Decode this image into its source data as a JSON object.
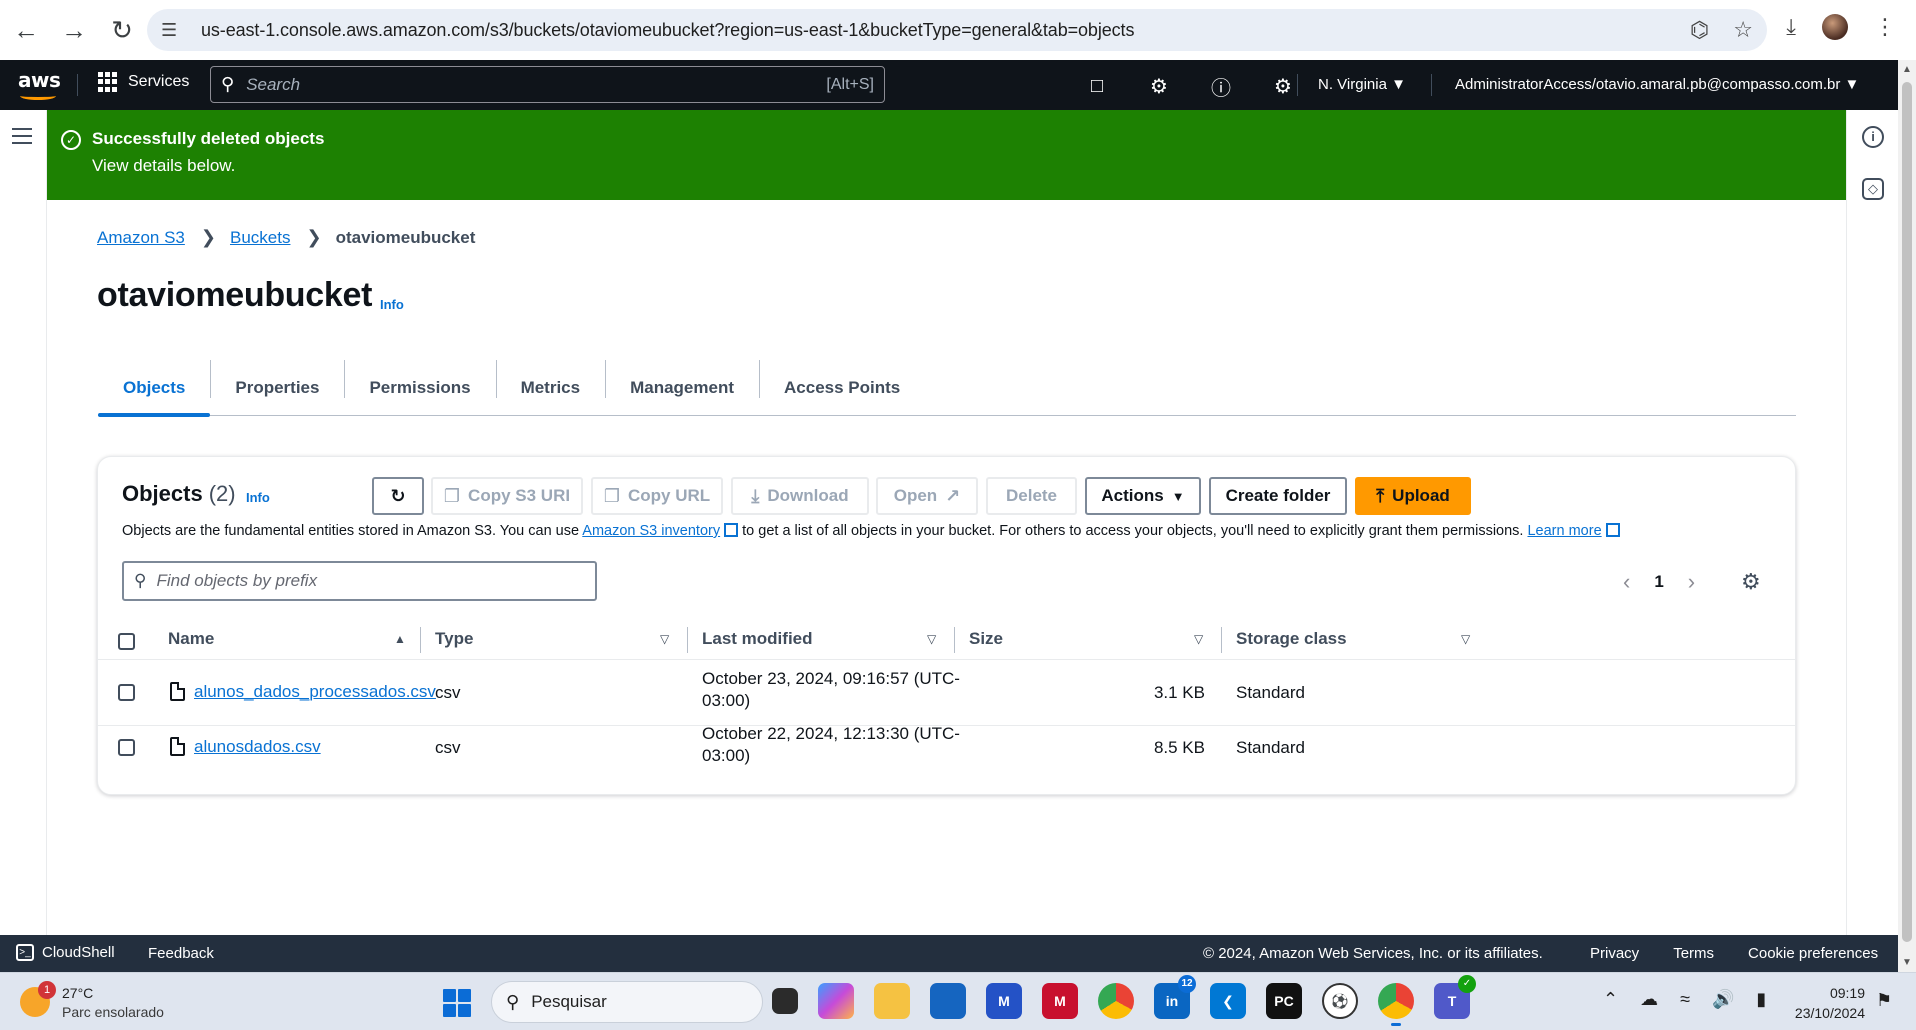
{
  "browser": {
    "url": "us-east-1.console.aws.amazon.com/s3/buckets/otaviomeubucket?region=us-east-1&bucketType=general&tab=objects"
  },
  "topnav": {
    "logo": "aws",
    "services_label": "Services",
    "search_placeholder": "Search",
    "search_shortcut": "[Alt+S]",
    "region": "N. Virginia ▼",
    "account": "AdministratorAccess/otavio.amaral.pb@compasso.com.br ▼"
  },
  "flash": {
    "title": "Successfully deleted objects",
    "detail": "View details below."
  },
  "breadcrumb": {
    "items": [
      "Amazon S3",
      "Buckets"
    ],
    "current": "otaviomeubucket"
  },
  "page": {
    "title": "otaviomeubucket",
    "info": "Info"
  },
  "tabs": [
    {
      "label": "Objects",
      "active": true
    },
    {
      "label": "Properties",
      "active": false
    },
    {
      "label": "Permissions",
      "active": false
    },
    {
      "label": "Metrics",
      "active": false
    },
    {
      "label": "Management",
      "active": false
    },
    {
      "label": "Access Points",
      "active": false
    }
  ],
  "objects": {
    "title": "Objects",
    "count": "(2)",
    "info": "Info",
    "desc_1": "Objects are the fundamental entities stored in Amazon S3. You can use",
    "inventory_link": "Amazon S3 inventory",
    "desc_2": "to get a list of all objects in your bucket. For others to access your objects, you'll need to explicitly grant them permissions.",
    "learn_more": "Learn more",
    "buttons": {
      "copy_s3_uri": "Copy S3 URI",
      "copy_url": "Copy URL",
      "download": "Download",
      "open": "Open",
      "delete": "Delete",
      "actions": "Actions",
      "create_folder": "Create folder",
      "upload": "Upload"
    },
    "filter_placeholder": "Find objects by prefix",
    "page_number": "1",
    "columns": [
      "Name",
      "Type",
      "Last modified",
      "Size",
      "Storage class"
    ],
    "rows": [
      {
        "name": "alunos_dados_processados.csv",
        "type": "csv",
        "modified_1": "October 23, 2024, 09:16:57 (UTC-",
        "modified_2": "03:00)",
        "size": "3.1 KB",
        "storage": "Standard"
      },
      {
        "name": "alunosdados.csv",
        "type": "csv",
        "modified_1": "October 22, 2024, 12:13:30 (UTC-",
        "modified_2": "03:00)",
        "size": "8.5 KB",
        "storage": "Standard"
      }
    ]
  },
  "footer": {
    "cloudshell": "CloudShell",
    "feedback": "Feedback",
    "copyright": "© 2024, Amazon Web Services, Inc. or its affiliates.",
    "privacy": "Privacy",
    "terms": "Terms",
    "cookies": "Cookie preferences"
  },
  "taskbar": {
    "weather_badge": "1",
    "temperature": "27°C",
    "condition": "Parc ensolarado",
    "search": "Pesquisar",
    "linkedin_badge": "12",
    "time": "09:19",
    "date": "23/10/2024"
  },
  "colors": {
    "aws_nav": "#0f141a",
    "flash_success": "#1d8102",
    "link": "#0972d3",
    "primary_button": "#ff9900",
    "footer": "#232f3e"
  }
}
